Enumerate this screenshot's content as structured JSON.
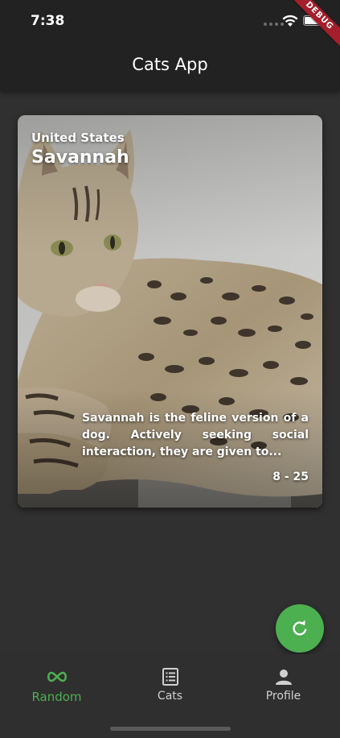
{
  "status_bar": {
    "time": "7:38",
    "debug_label": "DEBUG"
  },
  "app_bar": {
    "title": "Cats App"
  },
  "cat_card": {
    "country": "United States",
    "breed": "Savannah",
    "description": "Savannah is the feline version of a dog. Actively seeking social interaction, they are given to...",
    "life_span": "8 - 25"
  },
  "fab": {
    "icon": "refresh-icon",
    "color": "#4caf50"
  },
  "bottom_nav": {
    "active_color": "#4caf50",
    "items": [
      {
        "label": "Random",
        "icon": "infinity-icon",
        "active": true
      },
      {
        "label": "Cats",
        "icon": "list-icon",
        "active": false
      },
      {
        "label": "Profile",
        "icon": "person-icon",
        "active": false
      }
    ]
  }
}
